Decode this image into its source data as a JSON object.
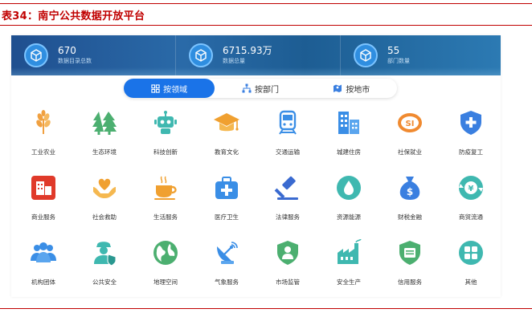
{
  "caption": "表34：南宁公共数据开放平台",
  "stats": [
    {
      "value": "670",
      "label": "数据目录总数"
    },
    {
      "value": "6715.93万",
      "label": "数据总量"
    },
    {
      "value": "55",
      "label": "部门数量"
    }
  ],
  "tabs": [
    {
      "label": "按领域",
      "icon": "grid-icon",
      "active": true
    },
    {
      "label": "按部门",
      "icon": "org-icon",
      "active": false
    },
    {
      "label": "按地市",
      "icon": "map-icon",
      "active": false
    }
  ],
  "categories": [
    {
      "label": "工业农业",
      "icon": "wheat-icon",
      "color": "#f0a040"
    },
    {
      "label": "生态环境",
      "icon": "tree-icon",
      "color": "#4caf70"
    },
    {
      "label": "科技创新",
      "icon": "robot-icon",
      "color": "#3fb8b0"
    },
    {
      "label": "教育文化",
      "icon": "graduation-cap-icon",
      "color": "#f0a030"
    },
    {
      "label": "交通运输",
      "icon": "train-icon",
      "color": "#3a8ee6"
    },
    {
      "label": "城建住房",
      "icon": "buildings-icon",
      "color": "#3a8ee6"
    },
    {
      "label": "社保就业",
      "icon": "social-security-icon",
      "color": "#f08a30"
    },
    {
      "label": "防疫复工",
      "icon": "medical-shield-icon",
      "color": "#3a7fe0"
    },
    {
      "label": "商业服务",
      "icon": "shop-icon",
      "color": "#e03a2a"
    },
    {
      "label": "社会救助",
      "icon": "heart-hand-icon",
      "color": "#f0a030"
    },
    {
      "label": "生活服务",
      "icon": "coffee-cup-icon",
      "color": "#f0a030"
    },
    {
      "label": "医疗卫生",
      "icon": "medical-kit-icon",
      "color": "#3a8ee6"
    },
    {
      "label": "法律服务",
      "icon": "gavel-icon",
      "color": "#3a6ad0"
    },
    {
      "label": "资源能源",
      "icon": "water-drop-icon",
      "color": "#3fb8b0"
    },
    {
      "label": "财税金融",
      "icon": "money-bag-icon",
      "color": "#3a7fe0"
    },
    {
      "label": "商贸流通",
      "icon": "currency-cycle-icon",
      "color": "#3fb8b0"
    },
    {
      "label": "机构团体",
      "icon": "group-icon",
      "color": "#3a8ee6"
    },
    {
      "label": "公共安全",
      "icon": "security-guard-icon",
      "color": "#3fb8b0"
    },
    {
      "label": "地理空间",
      "icon": "globe-icon",
      "color": "#4caf70"
    },
    {
      "label": "气象服务",
      "icon": "satellite-dish-icon",
      "color": "#3a8ee6"
    },
    {
      "label": "市场监管",
      "icon": "shield-person-icon",
      "color": "#4caf70"
    },
    {
      "label": "安全生产",
      "icon": "factory-icon",
      "color": "#3fb8b0"
    },
    {
      "label": "信用服务",
      "icon": "credit-shield-icon",
      "color": "#4caf70"
    },
    {
      "label": "其他",
      "icon": "four-squares-icon",
      "color": "#3fb8b0"
    }
  ]
}
